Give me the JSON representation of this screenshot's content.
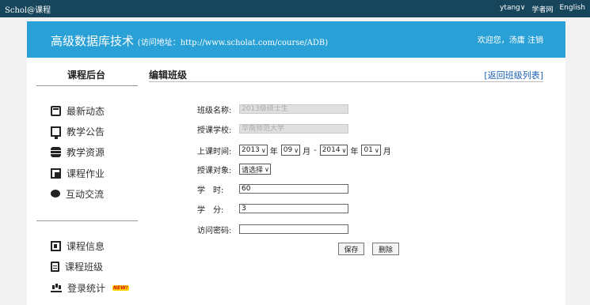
{
  "topbar": {
    "brand": "Schol@课程",
    "user": "ytang",
    "user_chevron": "chevron-down-icon",
    "links": [
      "学者网",
      "English"
    ]
  },
  "header": {
    "course_name": "高级数据库技术",
    "address_text": "(访问地址：http://www.scholat.com/course/ADB)",
    "welcome": "欢迎您，汤庸 注销"
  },
  "sidebar": {
    "title": "课程后台",
    "items": [
      {
        "label": "最新动态",
        "icon": "news-icon"
      },
      {
        "label": "教学公告",
        "icon": "announcement-icon"
      },
      {
        "label": "教学资源",
        "icon": "database-icon"
      },
      {
        "label": "课程作业",
        "icon": "homework-icon"
      },
      {
        "label": "互动交流",
        "icon": "chat-icon"
      }
    ],
    "items2": [
      {
        "label": "课程信息",
        "icon": "info-card-icon"
      },
      {
        "label": "课程班级",
        "icon": "class-icon"
      },
      {
        "label": "登录统计",
        "icon": "stats-icon",
        "badge": "NEW!"
      }
    ]
  },
  "main": {
    "title": "编辑班级",
    "back_link": "[返回班级列表]",
    "form": {
      "class_name_label": "班级名称:",
      "class_name_value": "2013级硕士生",
      "school_label": "授课学校:",
      "school_value": "华南师范大学",
      "time_label": "上课时间:",
      "start_year": "2013",
      "start_month": "09",
      "end_year": "2014",
      "end_month": "01",
      "year_unit": "年",
      "month_unit": "月",
      "dash": "-",
      "target_label": "授课对象:",
      "target_value": "请选择",
      "hours_label": "学　时:",
      "hours_value": "60",
      "credits_label": "学　分:",
      "credits_value": "3",
      "password_label": "访问密码:",
      "password_value": ""
    },
    "buttons": {
      "save": "保存",
      "delete": "删除"
    }
  }
}
